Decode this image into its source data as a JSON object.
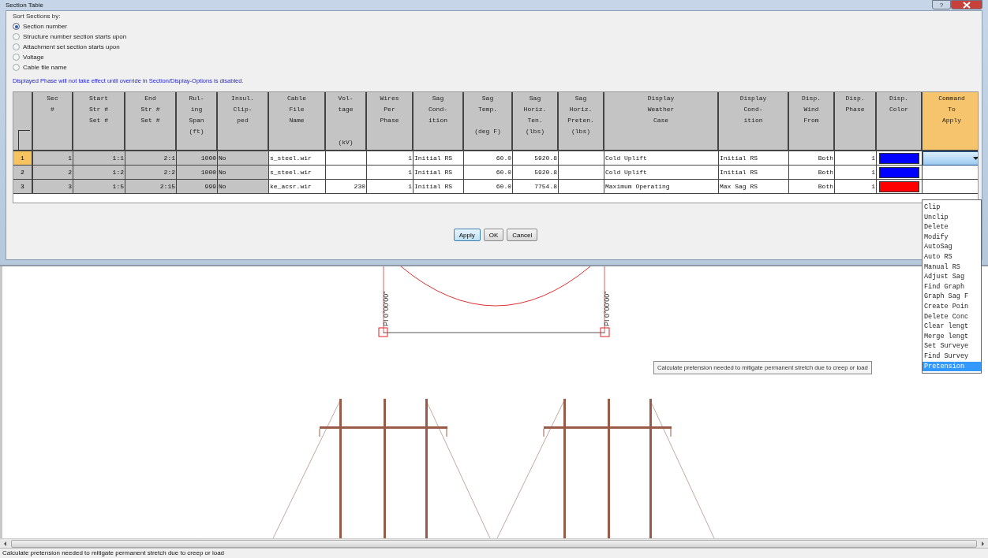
{
  "window": {
    "title": "Section Table",
    "help_button": "?"
  },
  "sort": {
    "legend": "Sort Sections by:",
    "options": [
      {
        "label": "Section number",
        "selected": true
      },
      {
        "label": "Structure number section starts upon",
        "selected": false
      },
      {
        "label": "Attachment set section starts upon",
        "selected": false
      },
      {
        "label": "Voltage",
        "selected": false
      },
      {
        "label": "Cable file name",
        "selected": false
      }
    ]
  },
  "note": "Displayed Phase will not take effect until override in Section/Display-Options is disabled.",
  "table": {
    "columns": [
      {
        "header": "Sec\n#",
        "kind": "number",
        "editable": false
      },
      {
        "header": "Start\nStr #\nSet #",
        "kind": "number",
        "editable": false
      },
      {
        "header": "End\nStr #\nSet #",
        "kind": "number",
        "editable": false
      },
      {
        "header": "Rul-\ning\nSpan\n(ft)",
        "kind": "number",
        "editable": false
      },
      {
        "header": "Insul.\nClip-\nped",
        "kind": "text",
        "editable": false
      },
      {
        "header": "Cable\nFile\nName",
        "kind": "text",
        "editable": true
      },
      {
        "header": "Vol-\ntage\n\n\n(kV)",
        "kind": "number",
        "editable": true
      },
      {
        "header": "Wires\nPer\nPhase",
        "kind": "number",
        "editable": true
      },
      {
        "header": "Sag\nCond-\nition",
        "kind": "text",
        "editable": true
      },
      {
        "header": "Sag\nTemp.\n\n(deg F)",
        "kind": "number",
        "editable": true
      },
      {
        "header": "Sag\nHoriz.\nTen.\n(lbs)",
        "kind": "number",
        "editable": true
      },
      {
        "header": "Sag\nHoriz.\nPreten.\n(lbs)",
        "kind": "number",
        "editable": true
      },
      {
        "header": "Display\nWeather\nCase",
        "kind": "text",
        "editable": true
      },
      {
        "header": "Display\nCond-\nition",
        "kind": "text",
        "editable": true
      },
      {
        "header": "Disp.\nWind\nFrom",
        "kind": "number",
        "editable": true
      },
      {
        "header": "Disp.\nPhase",
        "kind": "number",
        "editable": true
      },
      {
        "header": "Disp.\nColor",
        "kind": "color"
      },
      {
        "header": "Command\nTo\nApply",
        "kind": "command",
        "selected": true
      }
    ],
    "rows": [
      {
        "number": "1",
        "selected": true,
        "cells": [
          "1",
          "1:1",
          "2:1",
          "1000",
          "No",
          "s_steel.wir",
          null,
          "1",
          "Initial RS",
          "60.0",
          "5920.8",
          null,
          "Cold Uplift",
          "Initial RS",
          "Both",
          "1",
          {
            "color": "#0000ff"
          },
          {
            "open": true
          }
        ]
      },
      {
        "number": "2",
        "selected": false,
        "cells": [
          "2",
          "1:2",
          "2:2",
          "1000",
          "No",
          "s_steel.wir",
          null,
          "1",
          "Initial RS",
          "60.0",
          "5920.8",
          null,
          "Cold Uplift",
          "Initial RS",
          "Both",
          "1",
          {
            "color": "#0000ff"
          },
          null
        ]
      },
      {
        "number": "3",
        "selected": false,
        "cells": [
          "3",
          "1:5",
          "2:15",
          "999",
          "No",
          "ke_acsr.wir",
          "230",
          "1",
          "Initial RS",
          "60.0",
          "7754.8",
          null,
          "Maximum Operating",
          "Max Sag RS",
          "Both",
          "1",
          {
            "color": "#ff0000"
          },
          null
        ]
      }
    ]
  },
  "buttons": [
    {
      "label": "Apply",
      "default": true
    },
    {
      "label": "OK",
      "default": false
    },
    {
      "label": "Cancel",
      "default": false
    }
  ],
  "drawing": {
    "labels": [
      "PI 0°00'00\"",
      "PI 0°00'00\""
    ]
  },
  "dropdown": {
    "items": [
      {
        "label": "Clip",
        "selected": false
      },
      {
        "label": "Unclip",
        "selected": false
      },
      {
        "label": "Delete",
        "selected": false
      },
      {
        "label": "Modify",
        "selected": false
      },
      {
        "label": "AutoSag",
        "selected": false
      },
      {
        "label": "Auto RS",
        "selected": false
      },
      {
        "label": "Manual RS",
        "selected": false
      },
      {
        "label": "Adjust Sag",
        "selected": false
      },
      {
        "label": "Find Graph",
        "selected": false
      },
      {
        "label": "Graph Sag F",
        "selected": false
      },
      {
        "label": "Create Poin",
        "selected": false
      },
      {
        "label": "Delete Conc",
        "selected": false
      },
      {
        "label": "Clear lengt",
        "selected": false
      },
      {
        "label": "Merge lengt",
        "selected": false
      },
      {
        "label": "Set Surveye",
        "selected": false
      },
      {
        "label": "Find Survey",
        "selected": false
      },
      {
        "label": "Pretension",
        "selected": true
      }
    ]
  },
  "tooltip": "Calculate pretension needed to mitigate permanent stretch due to creep or load",
  "status_bar": "Calculate pretension needed to mitigate permanent stretch due to creep or load"
}
